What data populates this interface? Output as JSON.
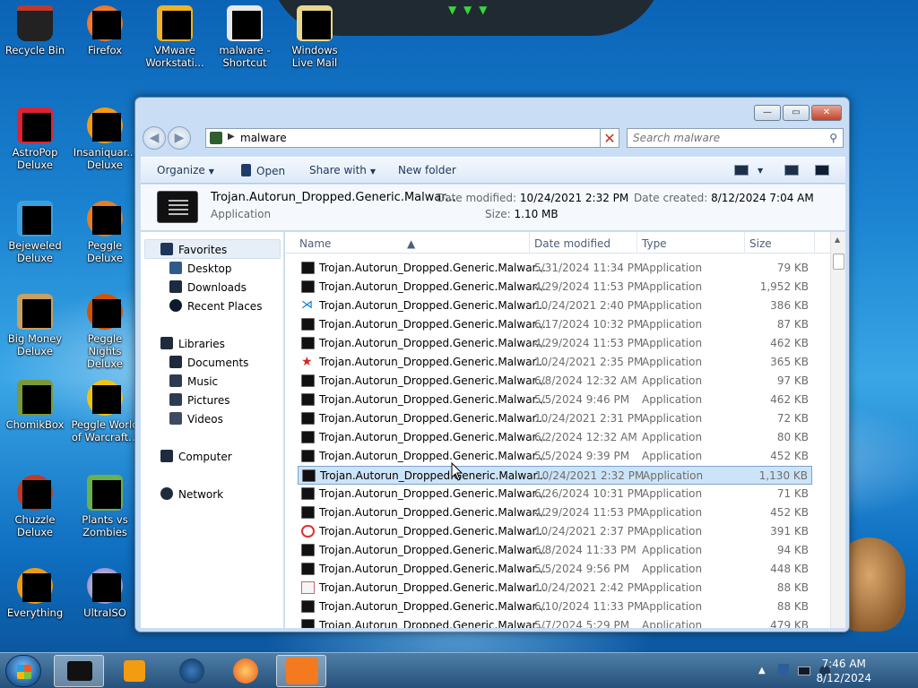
{
  "desktop": {
    "icons": [
      {
        "label": "Recycle Bin"
      },
      {
        "label": "Firefox"
      },
      {
        "label": "VMware Workstati..."
      },
      {
        "label": "malware - Shortcut"
      },
      {
        "label": "Windows Live Mail"
      },
      {
        "label": "AstroPop Deluxe"
      },
      {
        "label": "Insaniquar... Deluxe"
      },
      {
        "label": "Bejeweled Deluxe"
      },
      {
        "label": "Peggle Deluxe"
      },
      {
        "label": "Big Money Deluxe"
      },
      {
        "label": "Peggle Nights Deluxe"
      },
      {
        "label": "ChomikBox"
      },
      {
        "label": "Peggle World of Warcraft..."
      },
      {
        "label": "Chuzzle Deluxe"
      },
      {
        "label": "Plants vs Zombies"
      },
      {
        "label": "Everything"
      },
      {
        "label": "UltraISO"
      }
    ]
  },
  "explorer": {
    "address": "malware",
    "search_placeholder": "Search malware",
    "toolbar": {
      "organize": "Organize",
      "open": "Open",
      "share_with": "Share with",
      "new_folder": "New folder"
    },
    "details": {
      "name": "Trojan.Autorun_Dropped.Generic.Malwar...",
      "type": "Application",
      "date_modified_label": "Date modified:",
      "date_modified": "10/24/2021 2:32 PM",
      "date_created_label": "Date created:",
      "date_created": "8/12/2024 7:04 AM",
      "size_label": "Size:",
      "size": "1.10 MB"
    },
    "nav": {
      "favorites": "Favorites",
      "desktop": "Desktop",
      "downloads": "Downloads",
      "recent_places": "Recent Places",
      "libraries": "Libraries",
      "documents": "Documents",
      "music": "Music",
      "pictures": "Pictures",
      "videos": "Videos",
      "computer": "Computer",
      "network": "Network"
    },
    "columns": {
      "name": "Name",
      "date_modified": "Date modified",
      "type": "Type",
      "size": "Size"
    },
    "files": [
      {
        "name": "Trojan.Autorun_Dropped.Generic.Malwar...",
        "date": "5/31/2024 11:34 PM",
        "type": "Application",
        "size": "79 KB",
        "icon": "app-icon"
      },
      {
        "name": "Trojan.Autorun_Dropped.Generic.Malwar...",
        "date": "4/29/2024 11:53 PM",
        "type": "Application",
        "size": "1,952 KB",
        "icon": "app-icon"
      },
      {
        "name": "Trojan.Autorun_Dropped.Generic.Malwar...",
        "date": "10/24/2021 2:40 PM",
        "type": "Application",
        "size": "386 KB",
        "icon": "vscode-icon"
      },
      {
        "name": "Trojan.Autorun_Dropped.Generic.Malwar...",
        "date": "6/17/2024 10:32 PM",
        "type": "Application",
        "size": "87 KB",
        "icon": "app-icon"
      },
      {
        "name": "Trojan.Autorun_Dropped.Generic.Malwar...",
        "date": "4/29/2024 11:53 PM",
        "type": "Application",
        "size": "462 KB",
        "icon": "app-icon"
      },
      {
        "name": "Trojan.Autorun_Dropped.Generic.Malwar...",
        "date": "10/24/2021 2:35 PM",
        "type": "Application",
        "size": "365 KB",
        "icon": "star-icon"
      },
      {
        "name": "Trojan.Autorun_Dropped.Generic.Malwar...",
        "date": "6/8/2024 12:32 AM",
        "type": "Application",
        "size": "97 KB",
        "icon": "app-icon"
      },
      {
        "name": "Trojan.Autorun_Dropped.Generic.Malwar...",
        "date": "5/5/2024 9:46 PM",
        "type": "Application",
        "size": "462 KB",
        "icon": "app-icon"
      },
      {
        "name": "Trojan.Autorun_Dropped.Generic.Malwar...",
        "date": "10/24/2021 2:31 PM",
        "type": "Application",
        "size": "72 KB",
        "icon": "app-icon"
      },
      {
        "name": "Trojan.Autorun_Dropped.Generic.Malwar...",
        "date": "6/2/2024 12:32 AM",
        "type": "Application",
        "size": "80 KB",
        "icon": "app-icon"
      },
      {
        "name": "Trojan.Autorun_Dropped.Generic.Malwar...",
        "date": "5/5/2024 9:39 PM",
        "type": "Application",
        "size": "452 KB",
        "icon": "app-icon"
      },
      {
        "name": "Trojan.Autorun_Dropped.Generic.Malwar...",
        "date": "10/24/2021 2:32 PM",
        "type": "Application",
        "size": "1,130 KB",
        "icon": "app-icon",
        "selected": true
      },
      {
        "name": "Trojan.Autorun_Dropped.Generic.Malwar...",
        "date": "6/26/2024 10:31 PM",
        "type": "Application",
        "size": "71 KB",
        "icon": "app-icon"
      },
      {
        "name": "Trojan.Autorun_Dropped.Generic.Malwar...",
        "date": "4/29/2024 11:53 PM",
        "type": "Application",
        "size": "452 KB",
        "icon": "app-icon"
      },
      {
        "name": "Trojan.Autorun_Dropped.Generic.Malwar...",
        "date": "10/24/2021 2:37 PM",
        "type": "Application",
        "size": "391 KB",
        "icon": "target-icon"
      },
      {
        "name": "Trojan.Autorun_Dropped.Generic.Malwar...",
        "date": "6/8/2024 11:33 PM",
        "type": "Application",
        "size": "94 KB",
        "icon": "app-icon"
      },
      {
        "name": "Trojan.Autorun_Dropped.Generic.Malwar...",
        "date": "5/5/2024 9:56 PM",
        "type": "Application",
        "size": "448 KB",
        "icon": "app-icon"
      },
      {
        "name": "Trojan.Autorun_Dropped.Generic.Malwar...",
        "date": "10/24/2021 2:42 PM",
        "type": "Application",
        "size": "88 KB",
        "icon": "java-icon"
      },
      {
        "name": "Trojan.Autorun_Dropped.Generic.Malwar...",
        "date": "6/10/2024 11:33 PM",
        "type": "Application",
        "size": "88 KB",
        "icon": "app-icon"
      },
      {
        "name": "Trojan.Autorun_Dropped.Generic.Malwar...",
        "date": "5/7/2024 5:29 PM",
        "type": "Application",
        "size": "479 KB",
        "icon": "app-icon"
      }
    ]
  },
  "taskbar": {
    "time": "7:46 AM",
    "date": "8/12/2024"
  }
}
